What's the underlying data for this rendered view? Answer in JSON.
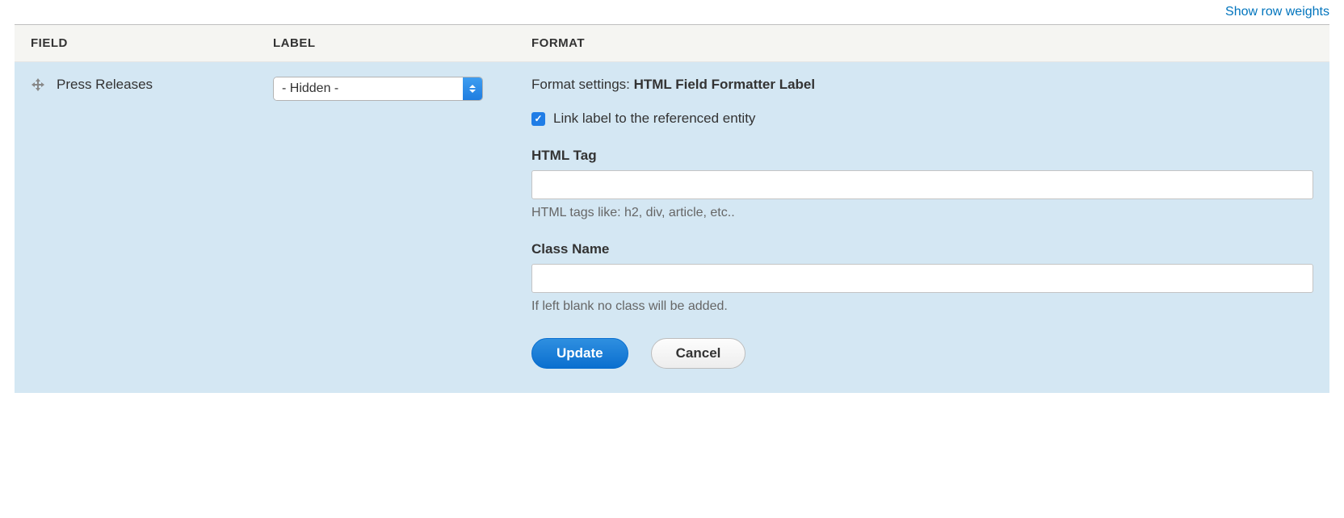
{
  "topLink": "Show row weights",
  "headers": {
    "field": "FIELD",
    "label": "LABEL",
    "format": "FORMAT"
  },
  "row": {
    "fieldName": "Press Releases",
    "labelSelected": "- Hidden -",
    "format": {
      "settingsPrefix": "Format settings: ",
      "settingsName": "HTML Field Formatter Label",
      "linkLabel": {
        "checked": true,
        "text": "Link label to the referenced entity"
      },
      "htmlTag": {
        "label": "HTML Tag",
        "value": "",
        "description": "HTML tags like: h2, div, article, etc.."
      },
      "className": {
        "label": "Class Name",
        "value": "",
        "description": "If left blank no class will be added."
      },
      "buttons": {
        "update": "Update",
        "cancel": "Cancel"
      }
    }
  }
}
